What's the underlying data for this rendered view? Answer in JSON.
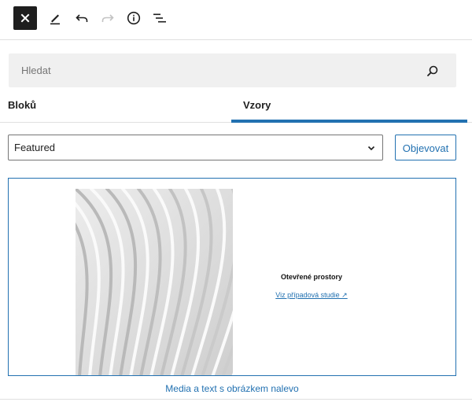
{
  "toolbar": {
    "icons": [
      "close-icon",
      "pencil-icon",
      "undo-icon",
      "redo-icon",
      "info-icon",
      "list-view-icon"
    ]
  },
  "search": {
    "placeholder": "Hledat"
  },
  "tabs": [
    {
      "label": "Bloků",
      "active": false
    },
    {
      "label": "Vzory",
      "active": true
    }
  ],
  "category": {
    "selected": "Featured"
  },
  "explore_button": {
    "label": "Objevovat"
  },
  "pattern": {
    "heading": "Otevřené prostory",
    "link": "Viz případová studie ↗",
    "caption": "Media a text s obrázkem nalevo"
  },
  "colors": {
    "accent": "#2271b1",
    "dark": "#1e1e1e",
    "search_bg": "#f0f0f0",
    "border": "#e0e0e0"
  }
}
